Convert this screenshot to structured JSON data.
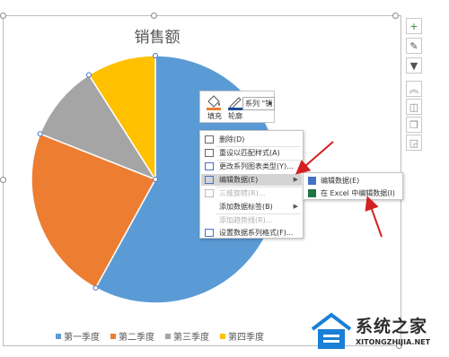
{
  "chart_data": {
    "type": "pie",
    "title": "销售额",
    "categories": [
      "第一季度",
      "第二季度",
      "第三季度",
      "第四季度"
    ],
    "values": [
      58,
      23,
      10,
      9
    ],
    "colors": [
      "#5b9bd5",
      "#ed7d31",
      "#a5a5a5",
      "#ffc000"
    ],
    "legend_position": "bottom"
  },
  "side_toolbar": {
    "buttons": [
      {
        "icon": "plus-icon",
        "glyph": "+"
      },
      {
        "icon": "brush-icon",
        "glyph": "✎"
      },
      {
        "icon": "filter-icon",
        "glyph": "▼"
      },
      {
        "icon": "chevrons-up-icon",
        "glyph": "︽"
      },
      {
        "icon": "layout-icon",
        "glyph": "◫"
      },
      {
        "icon": "copy-icon",
        "glyph": "❐"
      },
      {
        "icon": "resize-icon",
        "glyph": "◲"
      }
    ]
  },
  "mini_toolbar": {
    "fill_label": "填充",
    "outline_label": "轮廓",
    "series_value": "系列 \"销"
  },
  "context_menu": {
    "items": [
      {
        "label": "删除(D)",
        "icon": "delete-icon",
        "state": "normal"
      },
      {
        "label": "重设以匹配样式(A)",
        "icon": "reset-style-icon",
        "state": "normal"
      },
      {
        "label": "更改系列图表类型(Y)...",
        "icon": "chart-type-icon",
        "state": "normal"
      },
      {
        "label": "编辑数据(E)",
        "icon": "edit-data-icon",
        "state": "selected",
        "submenu": true
      },
      {
        "label": "三维旋转(R)...",
        "icon": "rotate-3d-icon",
        "state": "disabled"
      },
      {
        "label": "添加数据标签(B)",
        "icon": "",
        "state": "normal",
        "submenu": true
      },
      {
        "label": "添加趋势线(R)...",
        "icon": "",
        "state": "disabled"
      },
      {
        "label": "设置数据系列格式(F)...",
        "icon": "format-series-icon",
        "state": "normal"
      }
    ]
  },
  "submenu": {
    "items": [
      {
        "label": "编辑数据(E)",
        "icon": "edit-data-icon"
      },
      {
        "label": "在 Excel 中编辑数据(I)",
        "icon": "excel-icon"
      }
    ]
  },
  "watermark": {
    "name": "系统之家",
    "url": "XITONGZHIJIA.NET"
  },
  "colors": {
    "arrow_red": "#d42020",
    "selection_bg": "#d4d4d4",
    "brand_blue": "#1a7fd6"
  }
}
